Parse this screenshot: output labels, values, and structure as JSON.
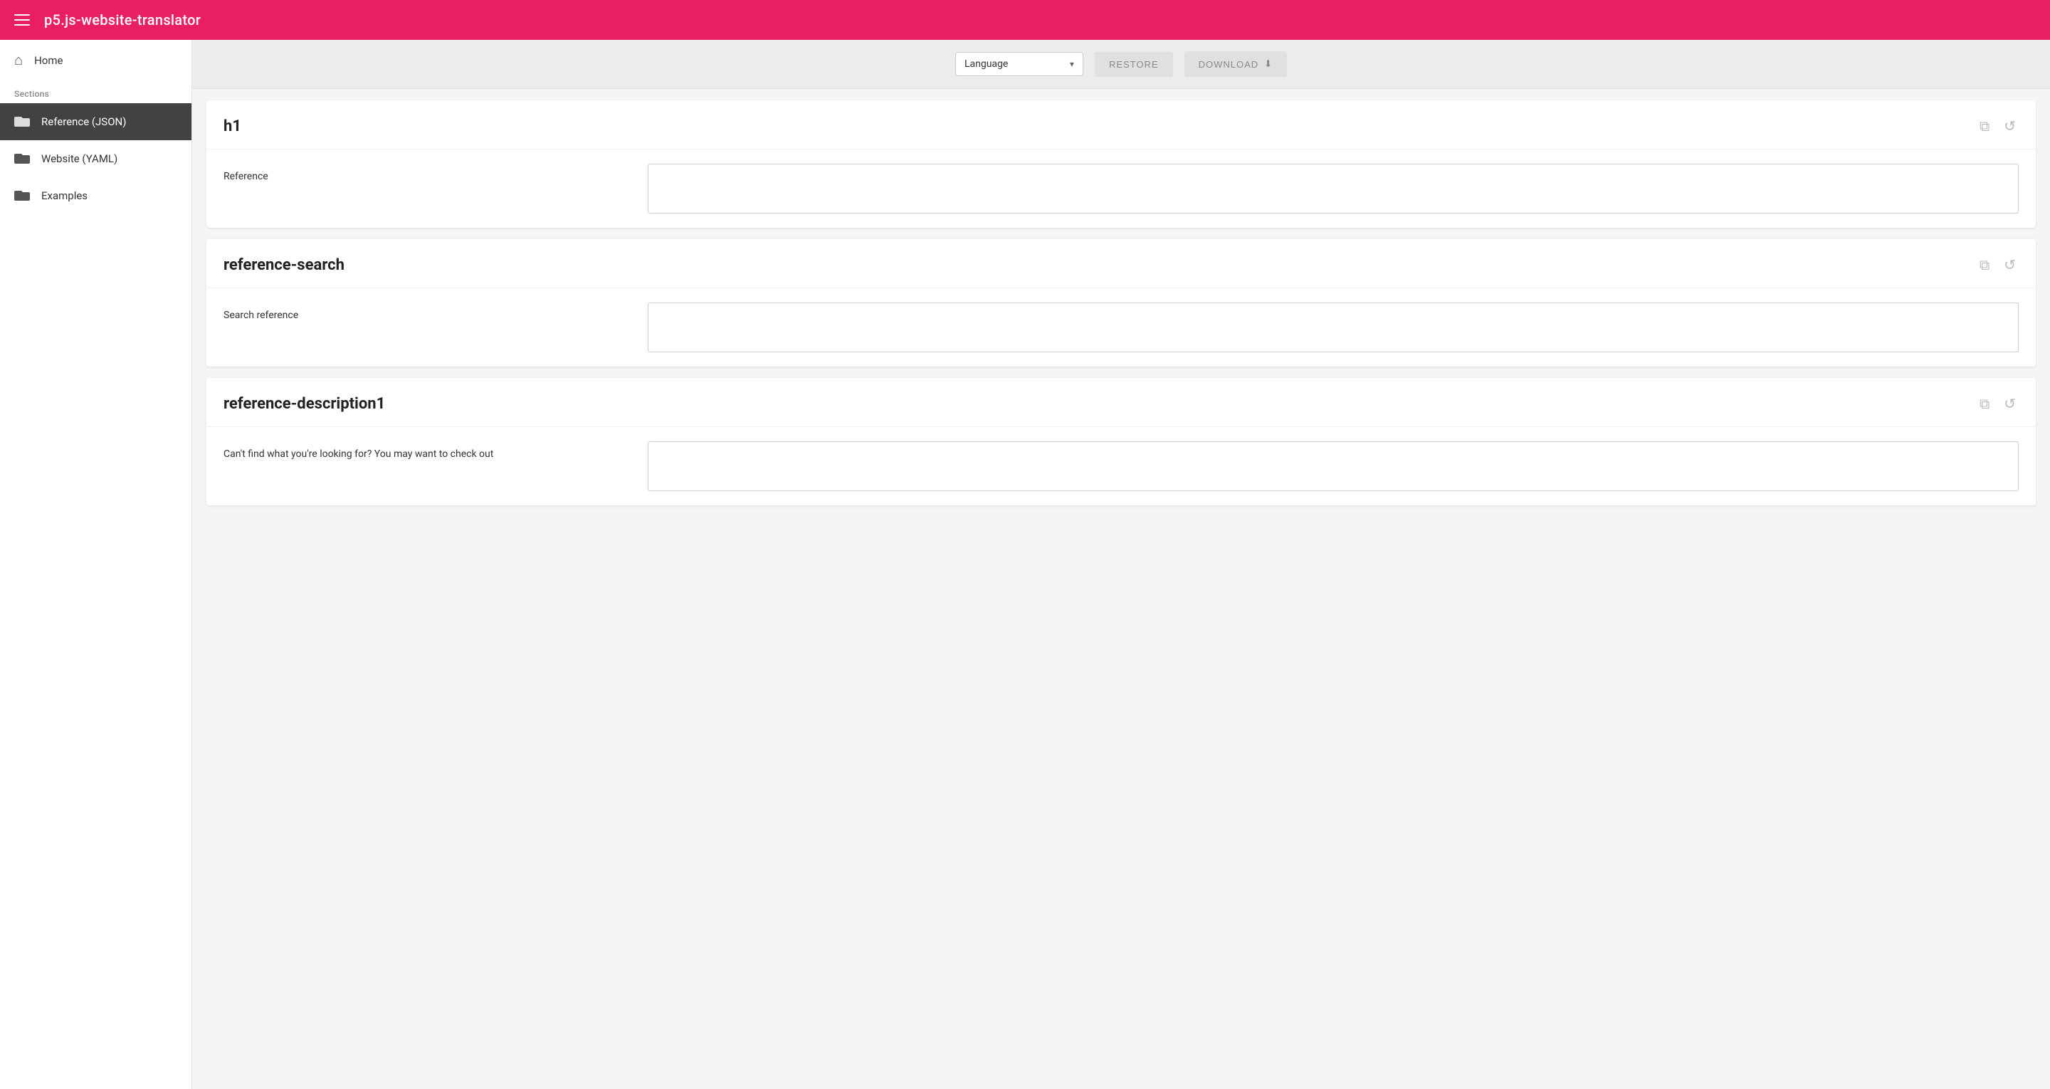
{
  "app": {
    "title": "p5.js-website-translator"
  },
  "toolbar": {
    "language_placeholder": "Language",
    "restore_label": "RESTORE",
    "download_label": "DOWNLOAD"
  },
  "sidebar": {
    "home_label": "Home",
    "sections_label": "Sections",
    "items": [
      {
        "id": "reference-json",
        "label": "Reference (JSON)",
        "active": true
      },
      {
        "id": "website-yaml",
        "label": "Website (YAML)",
        "active": false
      },
      {
        "id": "examples",
        "label": "Examples",
        "active": false
      }
    ]
  },
  "sections": [
    {
      "id": "h1",
      "title": "h1",
      "rows": [
        {
          "label": "Reference",
          "value": ""
        }
      ]
    },
    {
      "id": "reference-search",
      "title": "reference-search",
      "rows": [
        {
          "label": "Search reference",
          "value": ""
        }
      ]
    },
    {
      "id": "reference-description1",
      "title": "reference-description1",
      "rows": [
        {
          "label": "Can't find what you're looking for? You may want to check out",
          "value": ""
        }
      ]
    }
  ],
  "icons": {
    "hamburger": "☰",
    "home": "⌂",
    "folder": "▶",
    "chevron_down": "▾",
    "split_view": "⧉",
    "reset": "↺",
    "download": "⬇"
  }
}
